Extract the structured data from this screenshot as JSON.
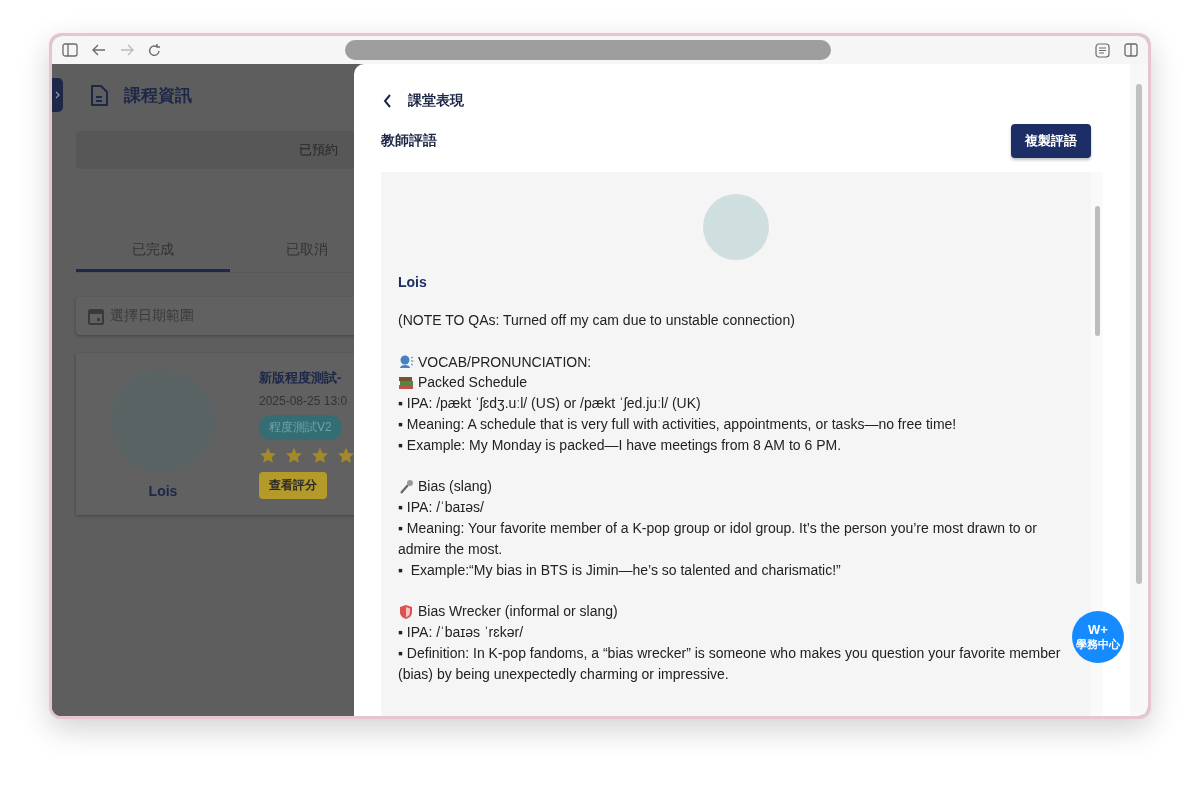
{
  "browser": {
    "back_disabled": false,
    "forward_disabled": true
  },
  "page": {
    "title": "課程資訊",
    "banner": "已預約",
    "tabs": [
      {
        "label": "已完成",
        "selected": true
      },
      {
        "label": "已取消",
        "selected": false
      }
    ],
    "date_field": {
      "placeholder": "選擇日期範圍"
    },
    "card": {
      "teacher": "Lois",
      "title": "新版程度測試-",
      "time": "2025-08-25 13:0",
      "tag": "程度測試V2",
      "stars": 4,
      "button": "查看評分"
    }
  },
  "drawer": {
    "title": "課堂表現",
    "section": "教師評語",
    "copy_button": "複製評語",
    "comment": {
      "teacher": "Lois",
      "lines": [
        {
          "kind": "text",
          "text": "(NOTE TO QAs: Turned off my cam due to unstable connection)"
        },
        {
          "kind": "spacer"
        },
        {
          "kind": "icon",
          "text": "VOCAB/PRONUNCIATION:"
        },
        {
          "kind": "icon",
          "text": "Packed Schedule"
        },
        {
          "kind": "text",
          "text": "▪ IPA: /pækt ˈʃɛdʒ.uːl/ (US) or /pækt ˈʃed.juːl/ (UK)"
        },
        {
          "kind": "text",
          "text": "▪ Meaning: A schedule that is very full with activities, appointments, or tasks—no free time!"
        },
        {
          "kind": "text",
          "text": "▪ Example: My Monday is packed—I have meetings from 8 AM to 6 PM."
        },
        {
          "kind": "spacer"
        },
        {
          "kind": "icon",
          "text": "Bias (slang)"
        },
        {
          "kind": "text",
          "text": "▪ IPA: /ˈbaɪəs/"
        },
        {
          "kind": "text",
          "text": "▪ Meaning: Your favorite member of a K-pop group or idol group. It’s the person you’re most drawn to or admire the most."
        },
        {
          "kind": "text",
          "text": "▪  Example:“My bias in BTS is Jimin—he’s so talented and charismatic!”"
        },
        {
          "kind": "spacer"
        },
        {
          "kind": "icon",
          "text": "Bias Wrecker (informal or slang)"
        },
        {
          "kind": "text",
          "text": "▪ IPA: /ˈbaɪəs ˈrɛkər/"
        },
        {
          "kind": "text",
          "text": "▪ Definition: In K-pop fandoms, a “bias wrecker” is someone who makes you question your favorite member (bias) by being unexpectedly charming or impressive."
        }
      ]
    }
  },
  "fab": {
    "badge": "W+",
    "label": "學務中心"
  }
}
